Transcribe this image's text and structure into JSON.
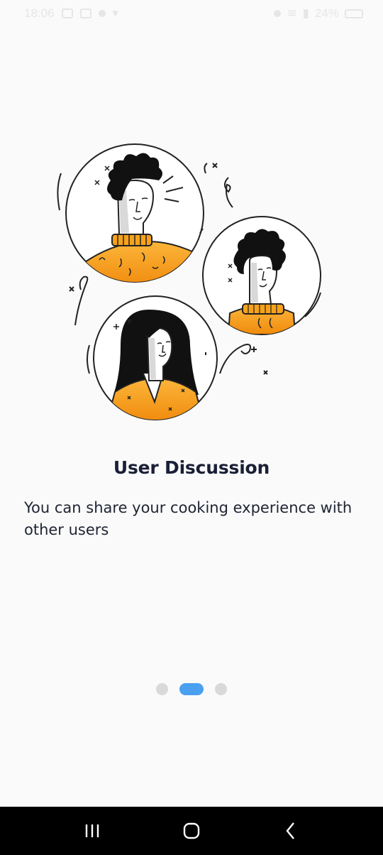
{
  "status_bar": {
    "time": "18:06",
    "right_text": "24%",
    "icons": [
      "image-icon",
      "message-icon",
      "sync-icon",
      "dropdown-icon",
      "alarm-icon",
      "wifi-icon",
      "signal-icon",
      "battery-icon"
    ]
  },
  "onboarding": {
    "title": "User Discussion",
    "description": "You can share your cooking experience with other users",
    "page_index": 2,
    "page_count": 3
  },
  "colors": {
    "accent": "#4aa0f0",
    "title": "#1a1f36",
    "sweater_orange": "#f7a21b",
    "background": "#fafafa"
  },
  "nav_bar": {
    "buttons": [
      "recent-apps-icon",
      "home-icon",
      "back-icon"
    ]
  }
}
